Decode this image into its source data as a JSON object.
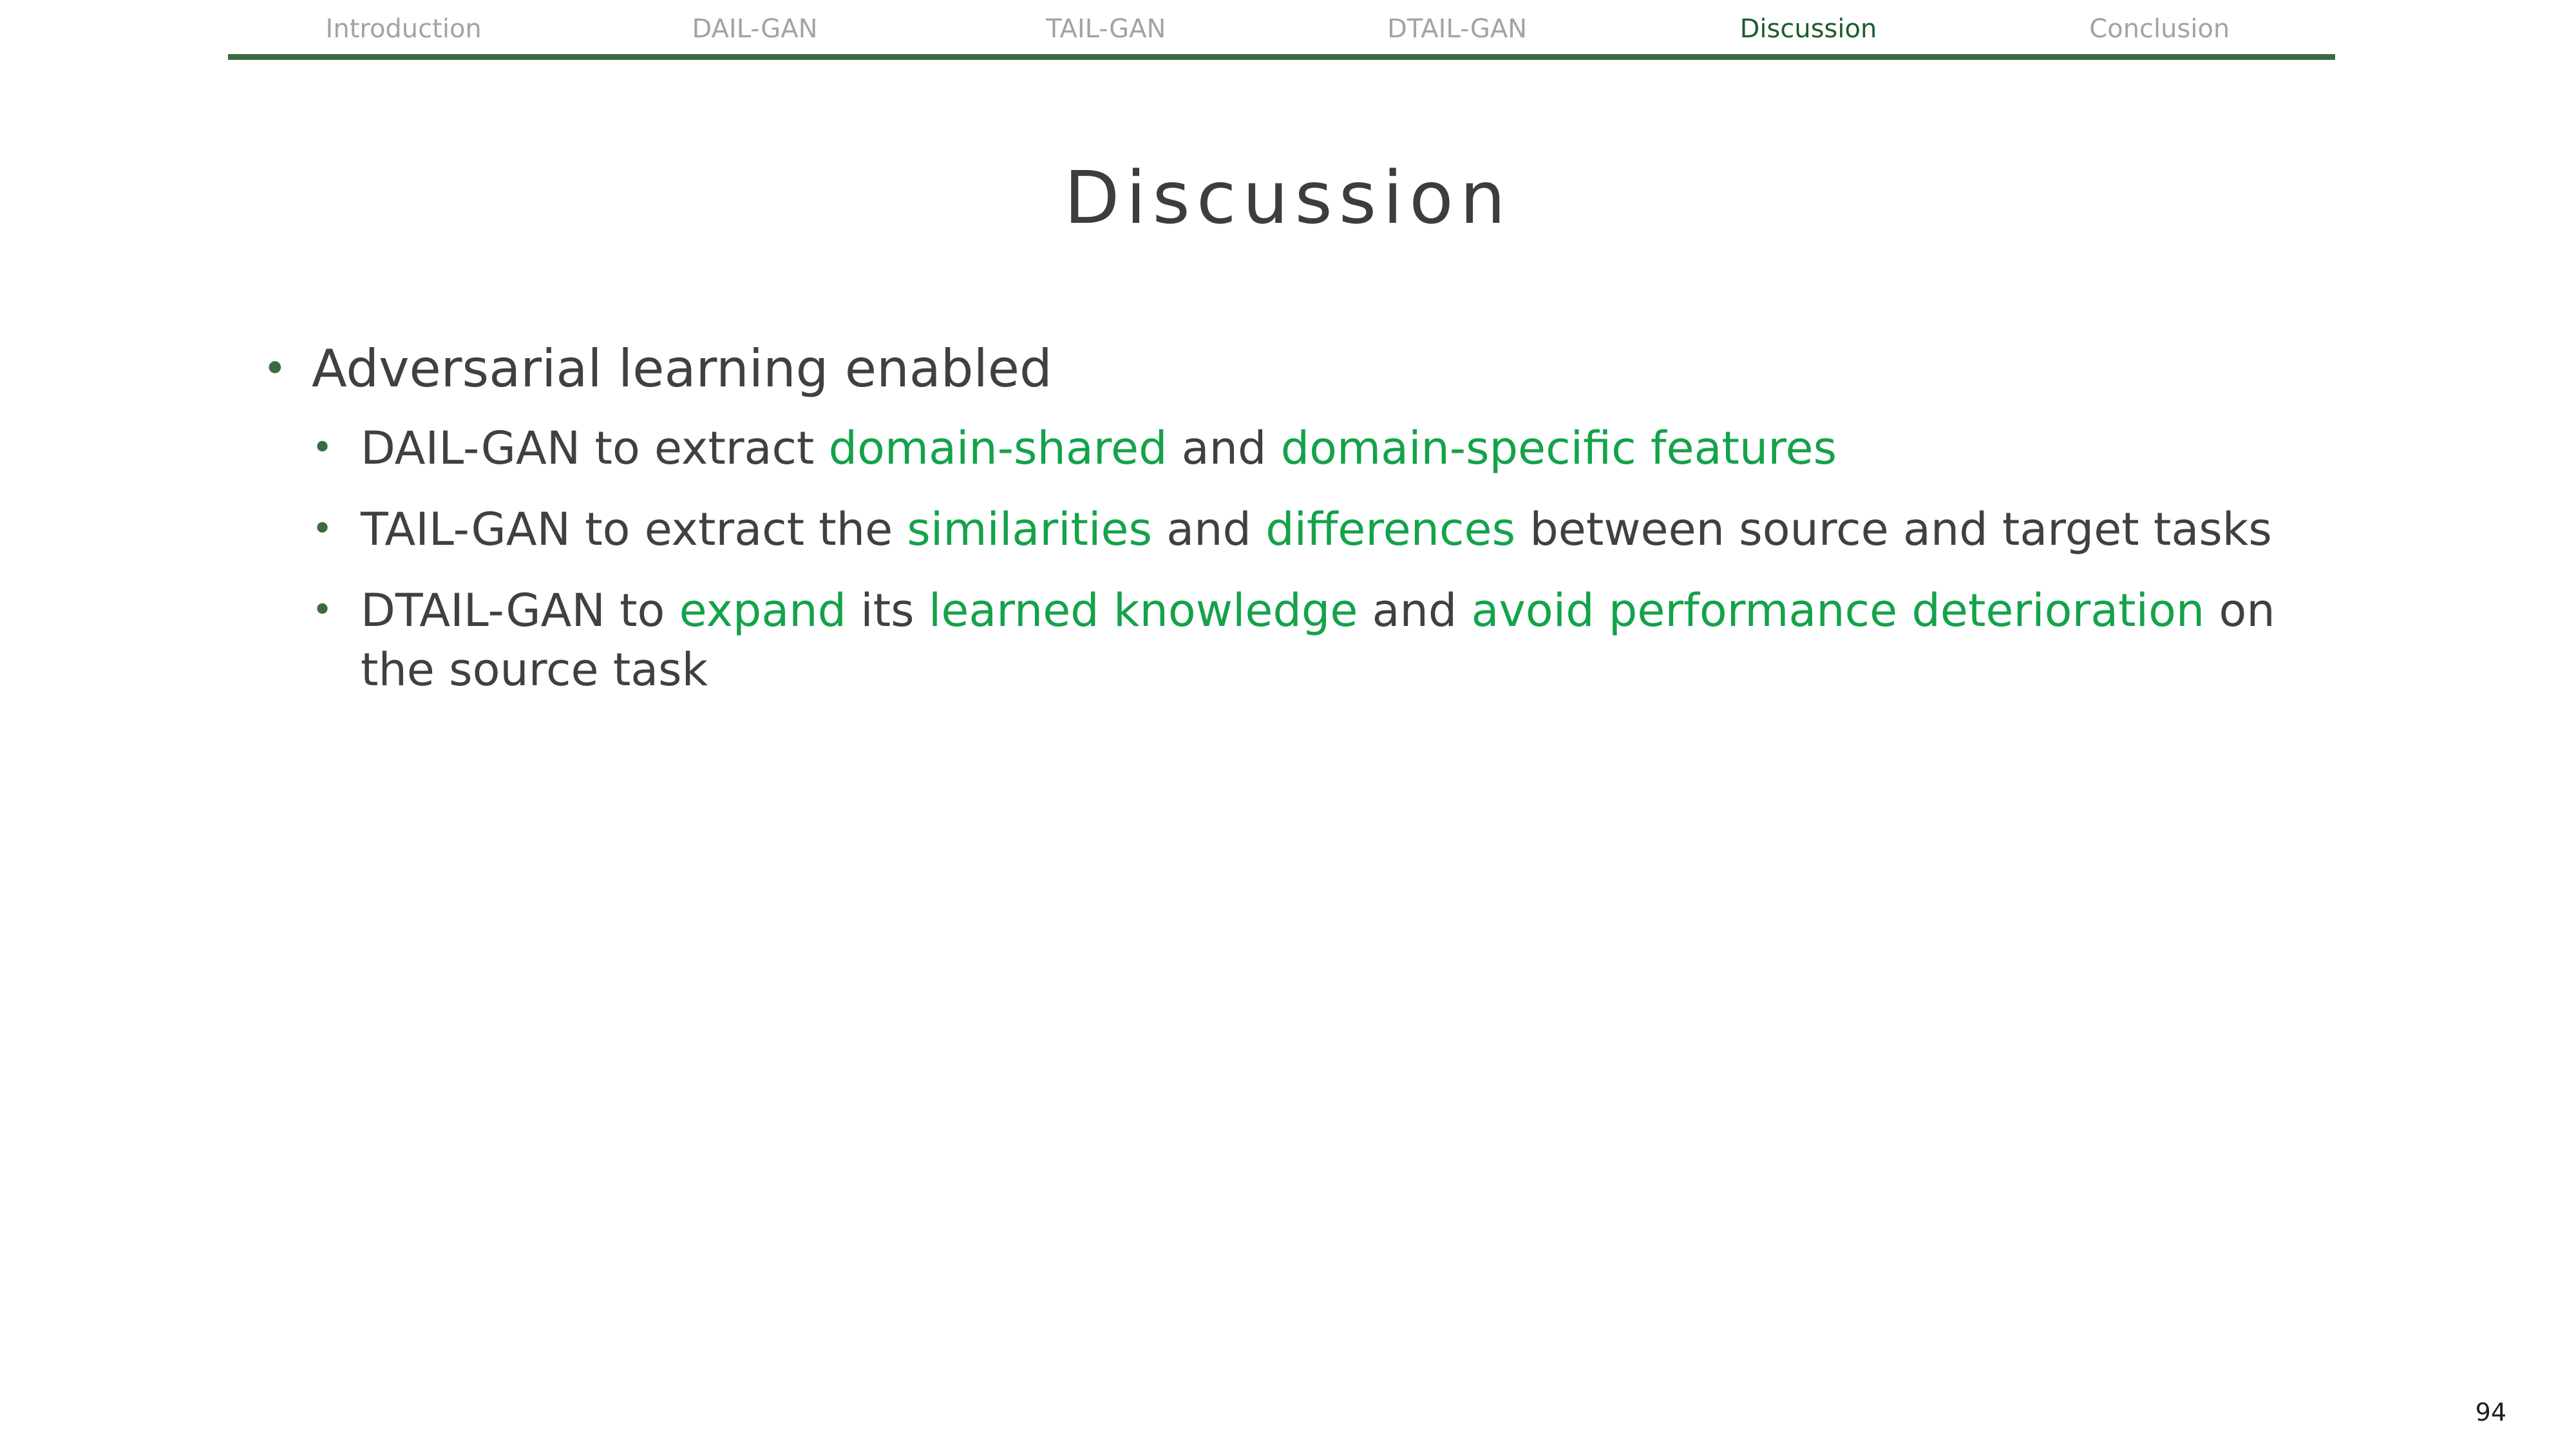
{
  "nav": {
    "items": [
      {
        "label": "Introduction"
      },
      {
        "label": "DAIL-GAN"
      },
      {
        "label": "TAIL-GAN"
      },
      {
        "label": "DTAIL-GAN"
      },
      {
        "label": "Discussion"
      },
      {
        "label": "Conclusion"
      }
    ],
    "active_index": 4
  },
  "title": "Discussion",
  "bullet": {
    "text": "Adversarial learning enabled",
    "subs": [
      {
        "parts": [
          "DAIL-GAN to extract ",
          "domain-shared",
          " and ",
          "domain-specific features"
        ]
      },
      {
        "parts": [
          "TAIL-GAN to extract the ",
          "similarities",
          " and ",
          "differences",
          " between source and target tasks"
        ]
      },
      {
        "parts": [
          "DTAIL-GAN to ",
          "expand",
          " its ",
          "learned knowledge",
          " and ",
          "avoid performance deterioration",
          " on the source task"
        ]
      }
    ]
  },
  "page_number": "94",
  "colors": {
    "highlight": "#14a24a",
    "accent": "#3a6b40",
    "text": "#404040",
    "nav_inactive": "#a3a3a3",
    "nav_active": "#1e5b2e"
  }
}
